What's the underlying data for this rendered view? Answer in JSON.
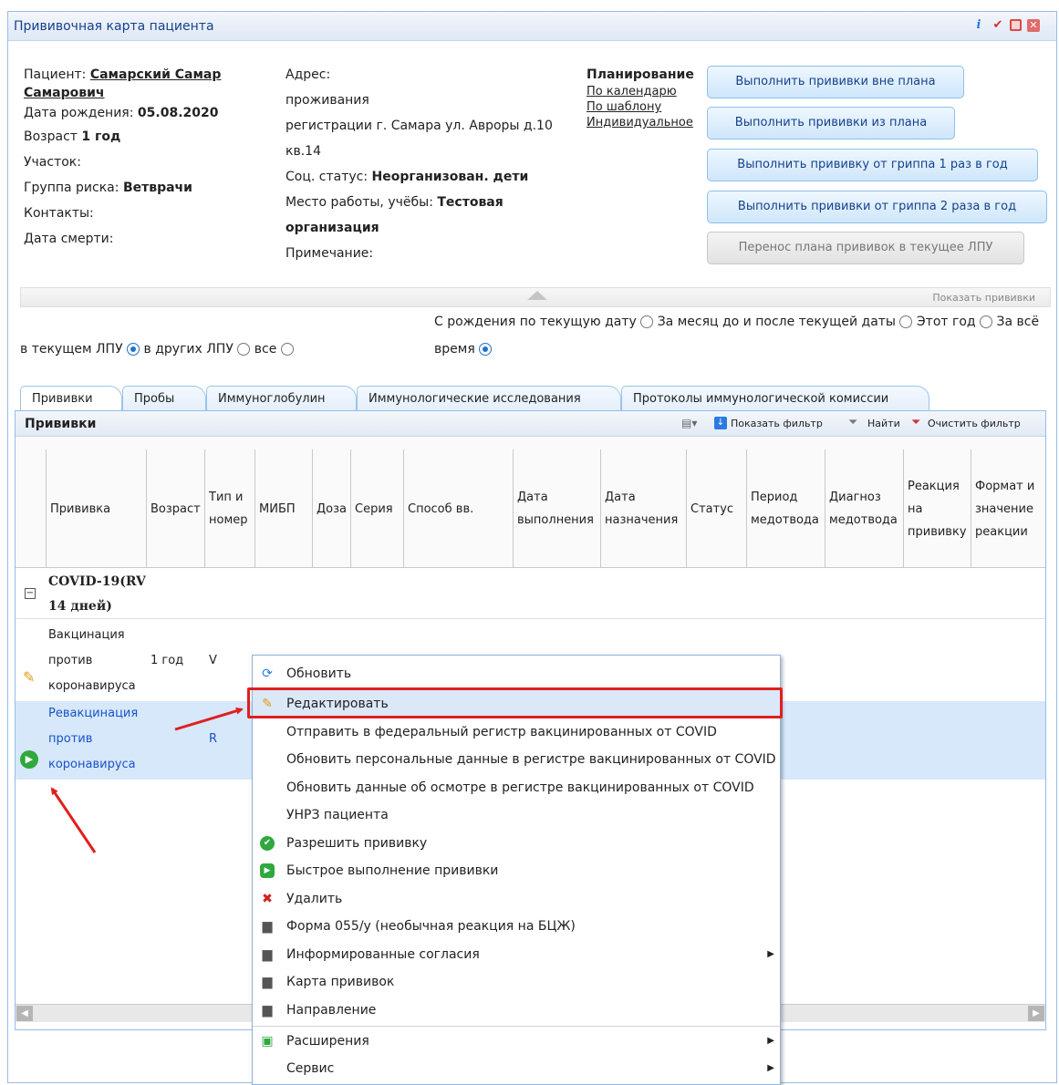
{
  "window": {
    "title": "Прививочная карта пациента"
  },
  "patient": {
    "patient_label": "Пациент:",
    "patient_name_1": "Самарский Самар",
    "patient_name_2": "Самарович",
    "dob_label": "Дата рождения:",
    "dob": "05.08.2020",
    "age_label": "Возраст",
    "age": "1 год",
    "district": "Участок:",
    "risk_label": "Группа риска:",
    "risk": "Ветврачи",
    "contacts": "Контакты:",
    "death": "Дата смерти:"
  },
  "address": {
    "label": "Адрес:",
    "residence": "проживания",
    "registration": "регистрации г. Самара ул. Авроры д.10",
    "registration_2": "кв.14",
    "social_label": "Соц. статус:",
    "social": "Неорганизован. дети",
    "work_label": "Место работы, учёбы:",
    "work_1": "Тестовая",
    "work_2": "организация",
    "note": "Примечание:"
  },
  "planning": {
    "title": "Планирование",
    "links": [
      "По календарю",
      "По шаблону",
      "Индивидуальное"
    ]
  },
  "buttons": [
    "Выполнить прививки вне плана",
    "Выполнить прививки из плана",
    "Выполнить прививку от гриппа 1 раз в год",
    "Выполнить прививки от гриппа 2 раза в год",
    "Перенос плана прививок в текущее ЛПУ"
  ],
  "show_vaccines": "Показать прививки",
  "period_filter": {
    "opt1": "С рождения по текущую дату",
    "opt2": "За месяц до и после текущей даты",
    "opt3": "Этот год",
    "opt4": "За всё",
    "opt4_cont": "время"
  },
  "lpu_filter": {
    "opt1": "в текущем ЛПУ",
    "opt2": "в других ЛПУ",
    "opt3": "все"
  },
  "tabs": [
    "Прививки",
    "Пробы",
    "Иммуноглобулин",
    "Иммунологические исследования",
    "Протоколы иммунологической комиссии"
  ],
  "grid": {
    "title": "Прививки",
    "show_filter": "Показать фильтр",
    "find": "Найти",
    "clear_filter": "Очистить фильтр",
    "columns": [
      "Прививка",
      "Возраст",
      "Тип и номер",
      "МИБП",
      "Доза",
      "Серия",
      "Способ вв.",
      "Дата выполнения",
      "Дата назначения",
      "Статус",
      "Период медотвода",
      "Диагноз медотвода",
      "Реакция на прививку",
      "Формат и значение реакции"
    ],
    "group_1": "COVID-19(RV",
    "group_2": "14 дней)",
    "row1": {
      "name_1": "Вакцинация",
      "name_2": "против",
      "name_3": "коронавируса",
      "age": "1 год",
      "type": "V"
    },
    "row2": {
      "name_1": "Ревакцинация",
      "name_2": "против",
      "name_3": "коронавируса",
      "type": "R"
    }
  },
  "context_menu": [
    "Обновить",
    "Редактировать",
    "Отправить в федеральный регистр вакцинированных от COVID",
    "Обновить персональные данные в регистре вакцинированных от COVID",
    "Обновить данные об осмотре в регистре вакцинированных от COVID",
    "УНРЗ пациента",
    "Разрешить прививку",
    "Быстрое выполнение прививки",
    "Удалить",
    "Форма 055/у (необычная реакция на БЦЖ)",
    "Информированные согласия",
    "Карта прививок",
    "Направление",
    "Расширения",
    "Сервис"
  ]
}
